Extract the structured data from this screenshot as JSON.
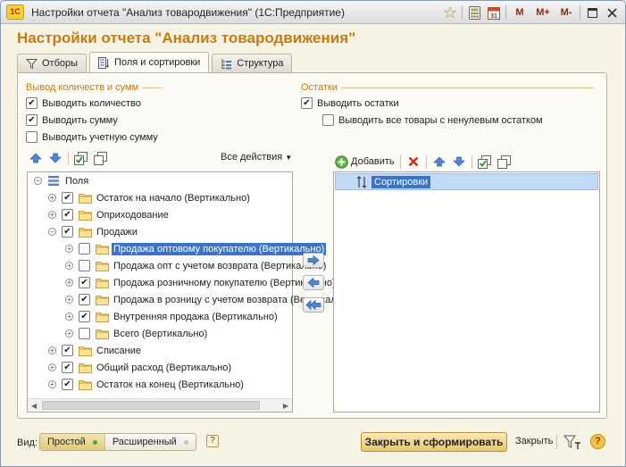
{
  "window": {
    "title": "Настройки отчета \"Анализ товародвижения\"  (1С:Предприятие)",
    "logo_text": "1С",
    "titlebar_icons": [
      "star-icon",
      "calculator-icon",
      "calendar-icon"
    ],
    "memory_buttons": [
      "M",
      "M+",
      "M-"
    ]
  },
  "heading": "Настройки отчета \"Анализ товародвижения\"",
  "tabs": [
    {
      "label": "Отборы",
      "icon": "filter-icon",
      "active": false
    },
    {
      "label": "Поля и сортировки",
      "icon": "fields-icon",
      "active": true
    },
    {
      "label": "Структура",
      "icon": "structure-icon",
      "active": false
    }
  ],
  "output_group": {
    "title": "Вывод количеств и сумм",
    "options": [
      {
        "label": "Выводить количество",
        "checked": true
      },
      {
        "label": "Выводить сумму",
        "checked": true
      },
      {
        "label": "Выводить учетную сумму",
        "checked": false
      }
    ]
  },
  "balances_group": {
    "title": "Остатки",
    "options": [
      {
        "label": "Выводить остатки",
        "checked": true
      },
      {
        "label": "Выводить все товары с ненулевым остатком",
        "checked": false
      }
    ]
  },
  "fields_toolbar": {
    "all_actions": "Все действия"
  },
  "fields_tree": {
    "root": "Поля",
    "rows": [
      {
        "label": "Остаток на начало (Вертикально)",
        "checked": true,
        "level": 1,
        "expander": "+",
        "selected": false
      },
      {
        "label": "Оприходование",
        "checked": true,
        "level": 1,
        "expander": "+",
        "selected": false
      },
      {
        "label": "Продажи",
        "checked": true,
        "level": 1,
        "expander": "-",
        "selected": false
      },
      {
        "label": "Продажа оптовому покупателю (Вертикально)",
        "checked": false,
        "level": 2,
        "expander": "+",
        "selected": true
      },
      {
        "label": "Продажа опт с учетом возврата (Вертикально)",
        "checked": false,
        "level": 2,
        "expander": "+",
        "selected": false
      },
      {
        "label": "Продажа розничному покупателю (Вертикально)",
        "checked": true,
        "level": 2,
        "expander": "+",
        "selected": false
      },
      {
        "label": "Продажа в розницу с учетом возврата (Вертикально)",
        "checked": true,
        "level": 2,
        "expander": "+",
        "selected": false
      },
      {
        "label": "Внутренняя продажа (Вертикально)",
        "checked": true,
        "level": 2,
        "expander": "+",
        "selected": false
      },
      {
        "label": "Всего (Вертикально)",
        "checked": false,
        "level": 2,
        "expander": "+",
        "selected": false
      },
      {
        "label": "Списание",
        "checked": true,
        "level": 1,
        "expander": "+",
        "selected": false
      },
      {
        "label": "Общий расход (Вертикально)",
        "checked": true,
        "level": 1,
        "expander": "+",
        "selected": false
      },
      {
        "label": "Остаток на конец (Вертикально)",
        "checked": true,
        "level": 1,
        "expander": "+",
        "selected": false
      }
    ]
  },
  "sort_toolbar": {
    "add_label": "Добавить"
  },
  "sort_list": {
    "rows": [
      {
        "label": "Сортировки"
      }
    ]
  },
  "bottom": {
    "view_label": "Вид:",
    "modes": [
      {
        "label": "Простой",
        "active": true
      },
      {
        "label": "Расширенный",
        "active": false
      }
    ],
    "help_small": "?",
    "generate_button": "Закрыть и сформировать",
    "close_button": "Закрыть",
    "help_round": "?"
  },
  "colors": {
    "accent": "#c87a10",
    "selection": "#3b74c7",
    "background": "#f7f3e4"
  }
}
